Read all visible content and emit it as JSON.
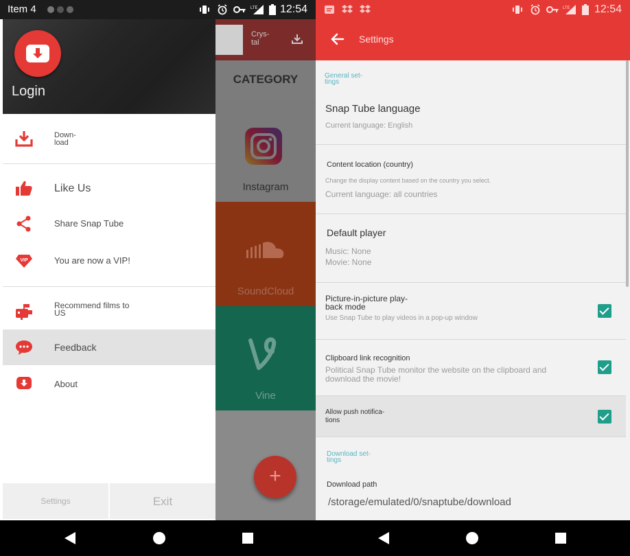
{
  "left": {
    "status_bar": {
      "left_text": "Item 4",
      "time": "12:54"
    },
    "drawer": {
      "login_label": "Login",
      "items": [
        {
          "label": "Down-\nload",
          "icon": "download-icon"
        },
        {
          "label": "Like Us",
          "icon": "thumbs-up-icon"
        },
        {
          "label": "Share Snap Tube",
          "icon": "share-icon"
        },
        {
          "label": "You are now a VIP!",
          "icon": "vip-diamond-icon"
        },
        {
          "label": "Recommend films to\nUS",
          "icon": "recommend-mailbox-icon"
        },
        {
          "label": "Feedback",
          "icon": "feedback-chat-icon"
        },
        {
          "label": "About",
          "icon": "about-icon"
        }
      ],
      "settings_label": "Settings",
      "exit_label": "Exit"
    },
    "background": {
      "header_text": "Crys-\ntal",
      "category_label": "CATEGORY",
      "categories": [
        {
          "label": "Instagram",
          "color": "#f4f4f4"
        },
        {
          "label": "SoundCloud",
          "color": "#d2491c"
        },
        {
          "label": "Vine",
          "color": "#17a57f"
        }
      ],
      "fab_label": "+"
    }
  },
  "right": {
    "status_bar": {
      "time": "12:54"
    },
    "toolbar_title": "Settings",
    "general_section_label": "General set-\ntings",
    "language": {
      "title": "Snap Tube language",
      "subtitle": "Current language: English"
    },
    "content_location": {
      "title": "Content location (country)",
      "description": "Change the display content based on the country you select.",
      "value": "Current language: all countries"
    },
    "default_player": {
      "title": "Default player",
      "music": "Music: None",
      "movie": "Movie: None"
    },
    "pip": {
      "title": "Picture-in-picture play-\nback mode",
      "subtitle": "Use Snap Tube to play videos in a pop-up window",
      "checked": true
    },
    "clipboard": {
      "title": "Clipboard link recognition",
      "subtitle": "Political Snap Tube monitor the website on the clipboard and\ndownload the movie!",
      "checked": true
    },
    "push": {
      "title": "Allow push notifica-\ntions",
      "checked": true
    },
    "download_section_label": "Download set-\ntings",
    "download_path": {
      "title": "Download path",
      "value": "/storage/emulated/0/snaptube/download"
    }
  },
  "colors": {
    "accent_red": "#e53935",
    "teal_check": "#1f9e8b",
    "section_teal": "#56b5c0"
  }
}
